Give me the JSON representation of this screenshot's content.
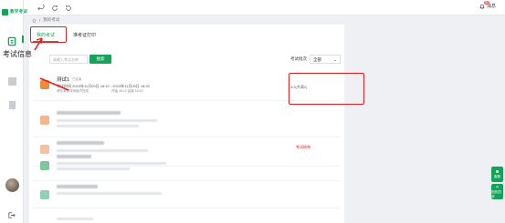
{
  "app": {
    "logo_text": "教学考试",
    "brand_color": "#15a35a"
  },
  "topbar": {
    "notify_label": "消息",
    "notify_count": "37"
  },
  "breadcrumb": {
    "current": "我的考试"
  },
  "tabs": [
    {
      "label": "我的考试",
      "active": true
    },
    {
      "label": "准考证打印",
      "active": false
    }
  ],
  "filters": {
    "search_placeholder": "请输入考试名称",
    "search_button": "搜索",
    "status_label": "考试批次",
    "status_value": "全部"
  },
  "annotation": {
    "text": "考试信息"
  },
  "exams": [
    {
      "title": "测试1",
      "tag": "已结束",
      "time_line": "考试时间 2023年11月09日 18:10 - 2023年11月09日 18:20",
      "sub_line_a": "请在考试时间段内完成",
      "sub_line_b": "开始 18:10  结束 18:10",
      "status": "0/3(共满2)"
    },
    {
      "status": ""
    },
    {
      "status": "考试结束"
    },
    {
      "status": ""
    }
  ],
  "float_buttons": [
    {
      "label": "客服"
    },
    {
      "label": "回到顶部"
    }
  ]
}
